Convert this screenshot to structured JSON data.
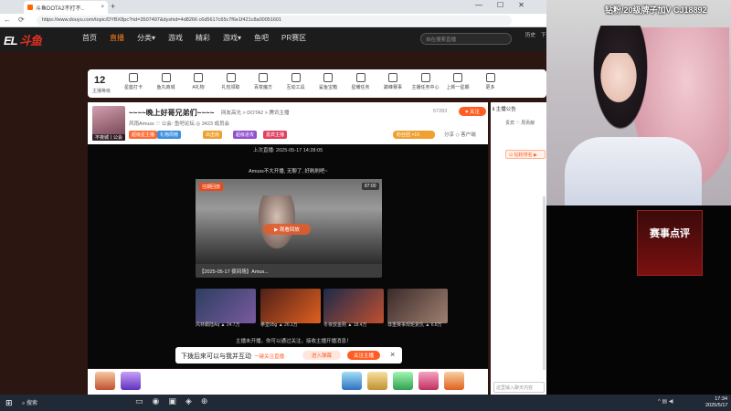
{
  "browser": {
    "tab_title": "斗鱼DOTA2不打不..",
    "tab_close": "×",
    "new_tab": "+",
    "win_controls": [
      "—",
      "☐",
      "✕"
    ],
    "nav_icons": [
      "←",
      "⟳"
    ],
    "url": "https://www.douyu.com/topic/DYBX8pc?rid=3507497&dyshid=4d8266 c6d5617c65c7f6e1f421c8a00051601"
  },
  "site": {
    "logo_left": "EL",
    "logo_right": "斗鱼",
    "nav": [
      "首页",
      "直播",
      "分类▾",
      "游戏",
      "精彩",
      "游戏▾",
      "鱼吧",
      "PR赛区"
    ],
    "active_nav": 1,
    "search_placeholder": "自在搜索直播",
    "header_icons": [
      "历史",
      "下载"
    ]
  },
  "toolbar": {
    "level": "12",
    "level_label": "主播等级",
    "tools": [
      "星座打卡",
      "鱼丸商城",
      "A礼物",
      "礼包领取",
      "百变魔方",
      "互动工具",
      "鲨鱼宝箱",
      "星耀任务",
      "巅峰赛事",
      "主播任务中心",
      "上新一星期",
      "更多"
    ]
  },
  "room": {
    "avatar_name": "不夜城丨公会",
    "title": "~~~~晚上好哥兄弟们~~~~",
    "meta": "网友高光 > DOTA2 > 腾讯主播",
    "sub": "风雨Amuss  ♡ 公会: 鱼吧论坛  ◎ 3423 成员会",
    "badges": [
      "超级星主播",
      "礼物周榜",
      "出击房",
      "超级进攻",
      "嘉宾主播"
    ],
    "heat": "57283",
    "follow": "♥ 关注",
    "fans_btn": "粉丝团 ×10",
    "share": "分享  ◇ 客户端"
  },
  "video": {
    "airtime": "上次直播: 2025-05-17 14:28:05",
    "title_over": "Amuss不大开播, 无聊了, 好刷刷吧~",
    "offline_tag": "往期回放",
    "offline_duration": "87:00",
    "play_label": "▶ 观看回放",
    "offline_caption": "【2025-05-17 夜间场】Amus...",
    "recs": [
      {
        "caption": "风林霸陆Aq   ▲ 24.7万",
        "c1": "#2c3e60",
        "c2": "#7a5aa0"
      },
      {
        "caption": "拳皇95g   ▲ 26.1万",
        "c1": "#502018",
        "c2": "#e06020"
      },
      {
        "caption": "冬夜放金刚 ▲ 18.4万",
        "c1": "#1c2a4a",
        "c2": "#c05030"
      },
      {
        "caption": "尊重赛事规矩复仇   ▲ 6.8万",
        "c1": "#3a2a2a",
        "c2": "#a08070"
      }
    ],
    "offline_msg": "主播未开播，你可以通过关注，接收主播开播消息！"
  },
  "notice": {
    "text": "下拨后來可以与我并互动",
    "link": "一键关注直播",
    "btn1": "进入弹幕",
    "btn2": "关注主播",
    "close": "×"
  },
  "chat": {
    "header": "ℹ 主播公告",
    "sub": "贵宾   ♡ 周贡献",
    "rank": "⊙ 钻粉排名  ▶",
    "input_placeholder": "这里输入聊天内容"
  },
  "cam": {
    "banner": "钻粉/20级牌子加V CJ18892"
  },
  "side": {
    "event_text": "赛事点评"
  },
  "taskbar": {
    "start": "⊞",
    "search": "⌕  搜索",
    "icons": [
      "▭",
      "◉",
      "▣",
      "◈",
      "⊕"
    ],
    "tray": "^  ▤  ◀",
    "time": "17:34",
    "date": "2025/5/17"
  },
  "colors": {
    "accent": "#ff5d23",
    "active_nav": "#ff7a1a"
  }
}
